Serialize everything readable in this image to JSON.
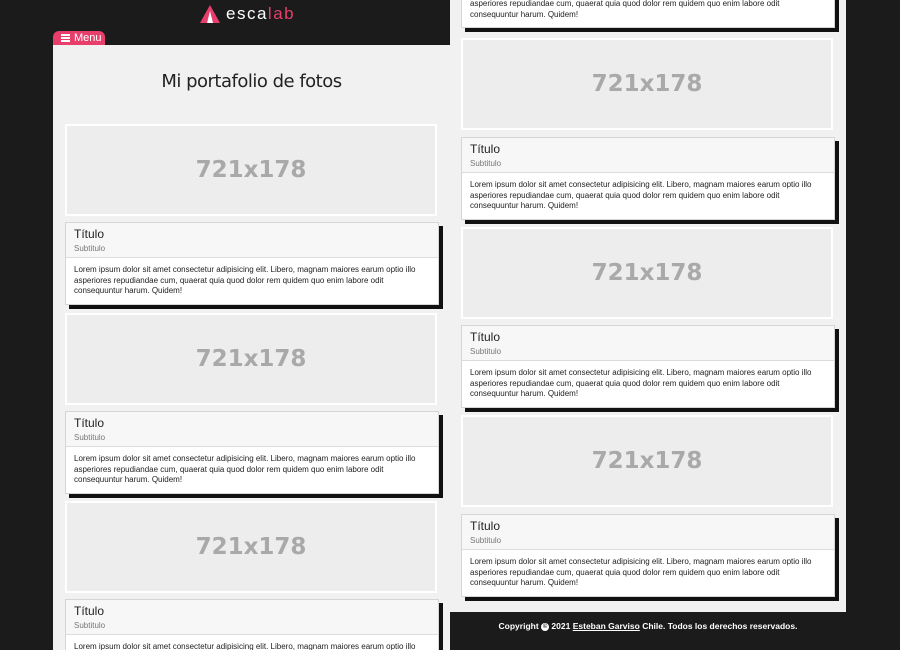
{
  "brand": {
    "name_part1": "esca",
    "name_part2": "lab"
  },
  "menu": {
    "label": "Menu"
  },
  "page": {
    "title": "Mi portafolio de fotos"
  },
  "placeholder_label": "721x178",
  "card": {
    "title": "Título",
    "subtitle": "Subtitulo",
    "text": "Lorem ipsum dolor sit amet consectetur adipisicing elit. Libero, magnam maiores earum optio illo asperiores repudiandae cum, quaerat quia quod dolor rem quidem quo enim labore odit consequuntur harum. Quidem!",
    "text_top": "asperiores repudiandae cum, quaerat quia quod dolor rem quidem quo enim labore odit consequuntur harum. Quidem!"
  },
  "footer": {
    "prefix": "Copyright",
    "year_text": "2021",
    "author": "Esteban Garviso",
    "suffix": "Chile. Todos los derechos reservados."
  },
  "colors": {
    "accent": "#e83e6c",
    "dark": "#1b1b1b",
    "panel": "#f1f1f1"
  }
}
